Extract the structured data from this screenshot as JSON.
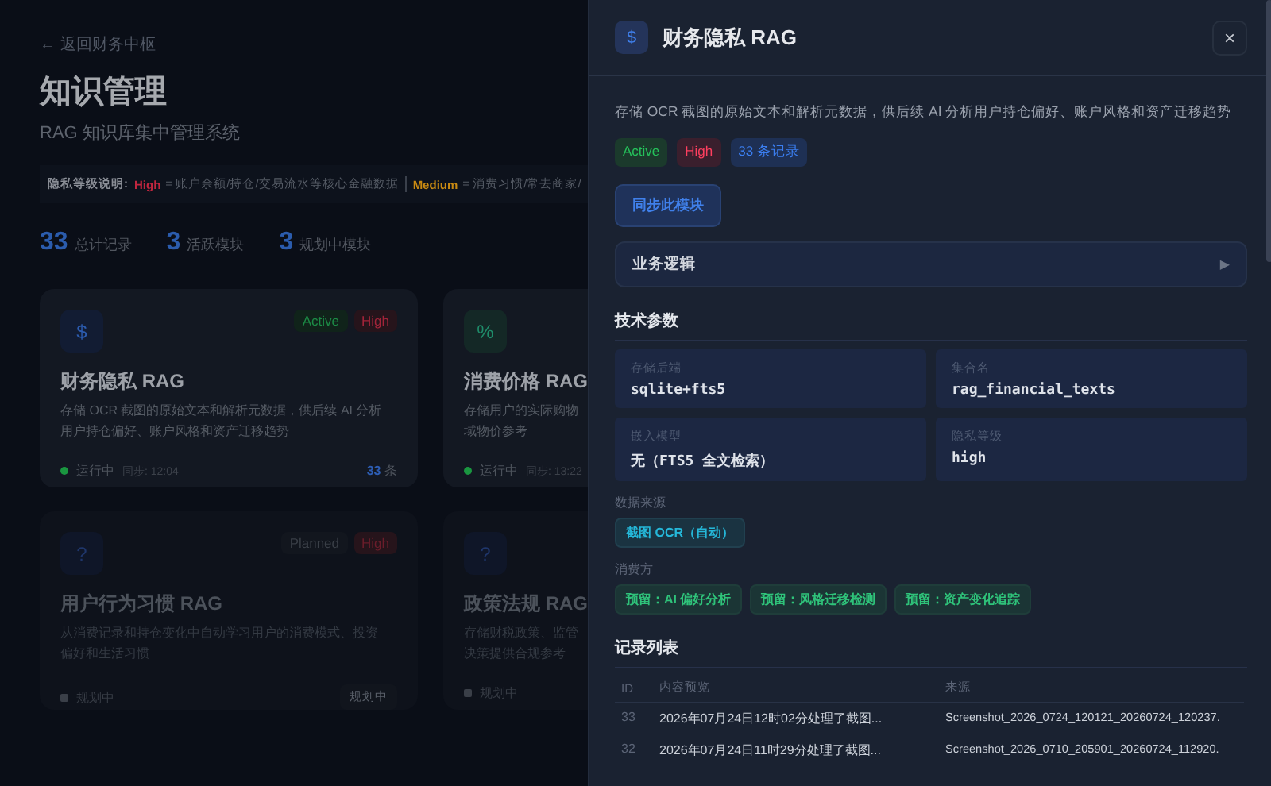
{
  "page": {
    "back_link": "← 返回财务中枢",
    "title": "知识管理",
    "subtitle": "RAG 知识库集中管理系统",
    "privacy_legend": {
      "label": "隐私等级说明:",
      "items": [
        {
          "level": "High",
          "text": "= 账户余额/持仓/交易流水等核心金融数据",
          "color": "#c0263f"
        },
        {
          "level": "Medium",
          "text": "= 消费习惯/常去商家/",
          "color": "#c98a12"
        }
      ]
    },
    "stats": [
      {
        "value": "33",
        "label": "总计记录"
      },
      {
        "value": "3",
        "label": "活跃模块"
      },
      {
        "value": "3",
        "label": "规划中模块"
      }
    ],
    "cards": [
      {
        "active": true,
        "icon": "$",
        "badges": [
          {
            "text": "Active",
            "kind": "active"
          },
          {
            "text": "High",
            "kind": "high"
          }
        ],
        "title": "财务隐私 RAG",
        "lines": [
          "存储 OCR 截图的原始文本和解析元数据，供后续 AI 分析",
          "用户持仓偏好、账户风格和资产迁移趋势"
        ],
        "state_text": "运行中",
        "sync": "同步: 12:04",
        "count": "33",
        "count_unit": "条"
      },
      {
        "active": true,
        "icon": "%",
        "title": "消费价格 RAG",
        "lines": [
          "存储用户的实际购物",
          "域物价参考"
        ],
        "state_text": "运行中",
        "sync": "同步: 13:22"
      },
      {
        "active": false,
        "icon": "?",
        "badges": [
          {
            "text": "Planned",
            "kind": "planned"
          },
          {
            "text": "High",
            "kind": "high"
          }
        ],
        "title": "用户行为习惯 RAG",
        "lines": [
          "从消费记录和持仓变化中自动学习用户的消费模式、投资",
          "偏好和生活习惯"
        ],
        "state_text": "规划中",
        "action": "规划中"
      },
      {
        "active": false,
        "icon": "?",
        "title": "政策法规 RAG",
        "lines": [
          "存储财税政策、监管",
          "决策提供合规参考"
        ],
        "state_text": "规划中"
      }
    ]
  },
  "drawer": {
    "icon": "$",
    "title": "财务隐私 RAG",
    "close": "×",
    "description": "存储 OCR 截图的原始文本和解析元数据，供后续 AI 分析用户持仓偏好、账户风格和资产迁移趋势",
    "badges": [
      {
        "text": "Active",
        "kind": "active"
      },
      {
        "text": "High",
        "kind": "high"
      },
      {
        "text": "33 条记录",
        "kind": "count"
      }
    ],
    "sync_button": "同步此模块",
    "logic": {
      "label": "业务逻辑",
      "expanded": false,
      "arrow": "▶"
    },
    "tech_title": "技术参数",
    "params": [
      {
        "label": "存储后端",
        "value": "sqlite+fts5"
      },
      {
        "label": "集合名",
        "value": "rag_financial_texts"
      },
      {
        "label": "嵌入模型",
        "value": "无（FTS5 全文检索）"
      },
      {
        "label": "隐私等级",
        "value": "high"
      }
    ],
    "sources_label": "数据来源",
    "sources": [
      "截图 OCR（自动）"
    ],
    "consumers_label": "消费方",
    "consumers": [
      "预留：AI 偏好分析",
      "预留：风格迁移检测",
      "预留：资产变化追踪"
    ],
    "records_title": "记录列表",
    "table": {
      "columns": [
        "ID",
        "内容预览",
        "来源"
      ],
      "rows": [
        [
          "33",
          "2026年07月24日12时02分处理了截图...",
          "Screenshot_2026_0724_120121_20260724_120237."
        ],
        [
          "32",
          "2026年07月24日11时29分处理了截图...",
          "Screenshot_2026_0710_205901_20260724_112920."
        ]
      ]
    }
  }
}
